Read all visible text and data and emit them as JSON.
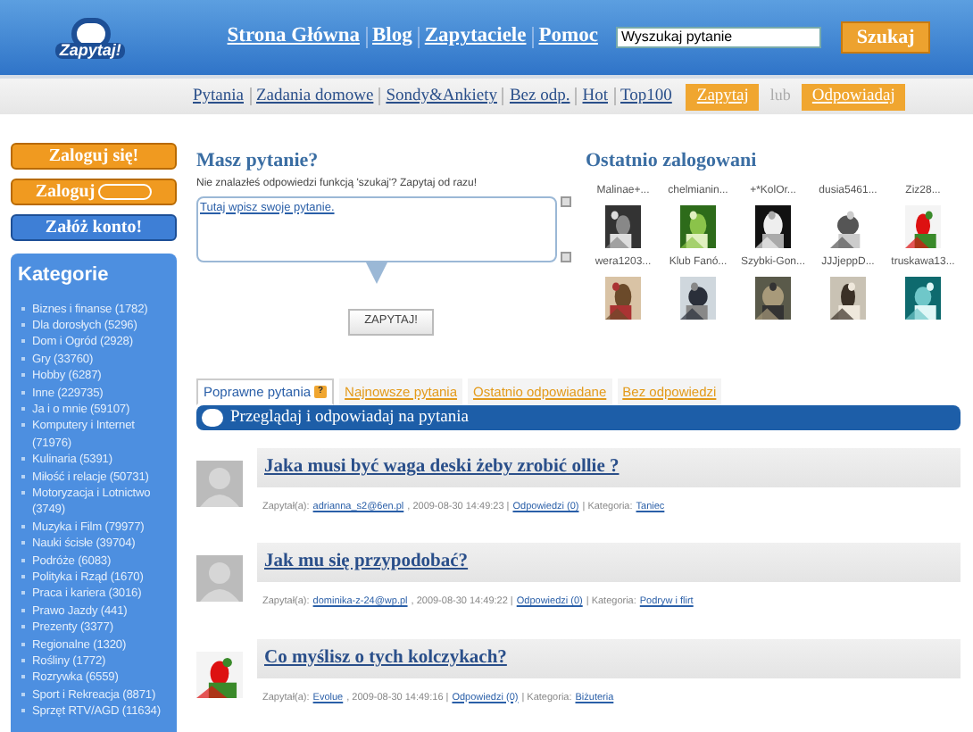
{
  "logo": {
    "text": "Zapytaj!"
  },
  "top_nav": [
    "Strona Główna",
    "Blog",
    "Zapytaciele",
    "Pomoc"
  ],
  "search": {
    "value": "Wyszukaj pytanie",
    "button": "Szukaj"
  },
  "sub_nav": {
    "links": [
      "Pytania",
      "Zadania domowe",
      "Sondy&Ankiety",
      "Bez odp.",
      "Hot",
      "Top100"
    ],
    "ask": "Zapytaj",
    "or": "lub",
    "answer": "Odpowiadaj"
  },
  "sidebar": {
    "login": "Zaloguj się!",
    "login_alt": "Zaloguj",
    "register": "Załóż konto!",
    "categories_title": "Kategorie",
    "categories": [
      "Biznes i finanse (1782)",
      "Dla dorosłych (5296)",
      "Dom i Ogród (2928)",
      "Gry (33760)",
      "Hobby (6287)",
      "Inne (229735)",
      "Ja i o mnie (59107)",
      "Komputery i Internet (71976)",
      "Kulinaria (5391)",
      "Miłość i relacje (50731)",
      "Motoryzacja i Lotnictwo (3749)",
      "Muzyka i Film (79977)",
      "Nauki ścisłe (39704)",
      "Podróże (6083)",
      "Polityka i Rząd (1670)",
      "Praca i kariera (3016)",
      "Prawo Jazdy (441)",
      "Prezenty (3377)",
      "Regionalne (1320)",
      "Rośliny (1772)",
      "Rozrywka (6559)",
      "Sport i Rekreacja (8871)",
      "Sprzęt RTV/AGD (11634)"
    ]
  },
  "ask_box": {
    "title": "Masz pytanie?",
    "hint": "Nie znalazłeś odpowiedzi funkcją 'szukaj'? Zapytaj od razu!",
    "placeholder": "Tutaj wpisz swoje pytanie.",
    "button": "ZAPYTAJ!"
  },
  "recent_users": {
    "title": "Ostatnio zalogowani",
    "users": [
      "Malinae+...",
      "chelmianin...",
      "+*KolOr...",
      "dusia5461...",
      "Ziz28...",
      "wera1203...",
      "Klub Fanó...",
      "Szybki-Gon...",
      "JJJjeppD...",
      "truskawa13..."
    ]
  },
  "tabs": [
    {
      "label": "Poprawne pytania",
      "selected": true,
      "badge": "?"
    },
    {
      "label": "Najnowsze pytania",
      "selected": false
    },
    {
      "label": "Ostatnio odpowiadane",
      "selected": false
    },
    {
      "label": "Bez odpowiedzi",
      "selected": false
    }
  ],
  "banner": "Przeglądaj i odpowiadaj na pytania",
  "questions": [
    {
      "title": "Jaka musi być waga deski żeby zrobić ollie ?",
      "asked_label": "Zapytał(a):",
      "author": "adrianna_s2@6en.pl",
      "date": ", 2009-08-30 14:49:23 |",
      "answers": "Odpowiedzi (0)",
      "category_label": "| Kategoria:",
      "category": "Taniec",
      "kind": "placeholder"
    },
    {
      "title": "Jak mu się przypodobać?",
      "asked_label": "Zapytał(a):",
      "author": "dominika-z-24@wp.pl",
      "date": ", 2009-08-30 14:49:22 |",
      "answers": "Odpowiedzi (0)",
      "category_label": "| Kategoria:",
      "category": "Podryw i flirt",
      "kind": "placeholder"
    },
    {
      "title": "Co myślisz o tych kolczykach?",
      "asked_label": "Zapytał(a):",
      "author": "Evolue",
      "date": ", 2009-08-30 14:49:16 |",
      "answers": "Odpowiedzi (0)",
      "category_label": "| Kategoria:",
      "category": "Biżuteria"
    }
  ]
}
